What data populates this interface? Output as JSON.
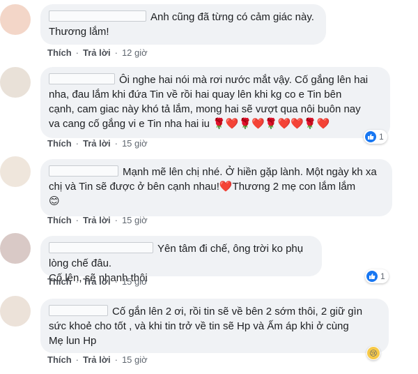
{
  "comments": [
    {
      "text_line1": "Anh cũng đã từng có cảm giác này.",
      "text_line2": "Thương lắm!",
      "like_label": "Thích",
      "reply_label": "Trả lời",
      "time": "12 giờ",
      "avatar_color": "#f3d6c8"
    },
    {
      "text_line1": "Ôi nghe hai nói mà rơi nước mắt vậy. Cố gắng lên hai",
      "text_line2": "nha, đau lắm khi đứa Tin về rồi hai quay lên khi kg co e Tin bên",
      "text_line3": "cạnh, cam giac này khó tả lắm, mong hai sẽ vượt qua nôi buôn nay",
      "text_line4": "va cang cố gắng vi e Tin nha hai iu",
      "emoji_tail": "🌹❤️🌹❤️🌹❤️❤️🌹❤️",
      "like_label": "Thích",
      "reply_label": "Trả lời",
      "time": "15 giờ",
      "reaction_count": "1",
      "avatar_color": "#e9e1d8"
    },
    {
      "text_line1": "Mạnh mẽ lên chị nhé. Ở hiền gặp lành. Một ngày kh xa",
      "text_line2": "chị và Tin sẽ được ở bên cạnh nhau!",
      "text_line2_heart": "❤️",
      "text_line2_tail": "Thương 2 mẹ con lắm lắm",
      "text_line3": "😊",
      "like_label": "Thích",
      "reply_label": "Trả lời",
      "time": "15 giờ",
      "avatar_color": "#efe6dc"
    },
    {
      "text_line1": "Yên tâm đi chế, ông trời ko phụ lòng chế đâu.",
      "text_line2": "Cố lên, sẽ nhanh thôi",
      "like_label": "Thích",
      "reply_label": "Trả lời",
      "time": "15 giờ",
      "reaction_count": "1",
      "avatar_color": "#d9c9c6"
    },
    {
      "text_line1": "Cố gắn lên 2 ơi, rồi tin sẽ về bên 2 sớm thôi, 2 giữ gìn",
      "text_line2": "sức khoẻ cho tốt , và khi tin trở về tin sẽ Hp và Ấm áp khi ở cùng",
      "text_line3": "Mẹ lun Hp",
      "like_label": "Thích",
      "reply_label": "Trả lời",
      "time": "15 giờ",
      "reaction_emoji": "😢",
      "avatar_color": "#ece2d9"
    }
  ],
  "colors": {
    "bubble": "#f0f2f5",
    "action_text": "#4b4f56",
    "like_blue": "#1877f2"
  }
}
